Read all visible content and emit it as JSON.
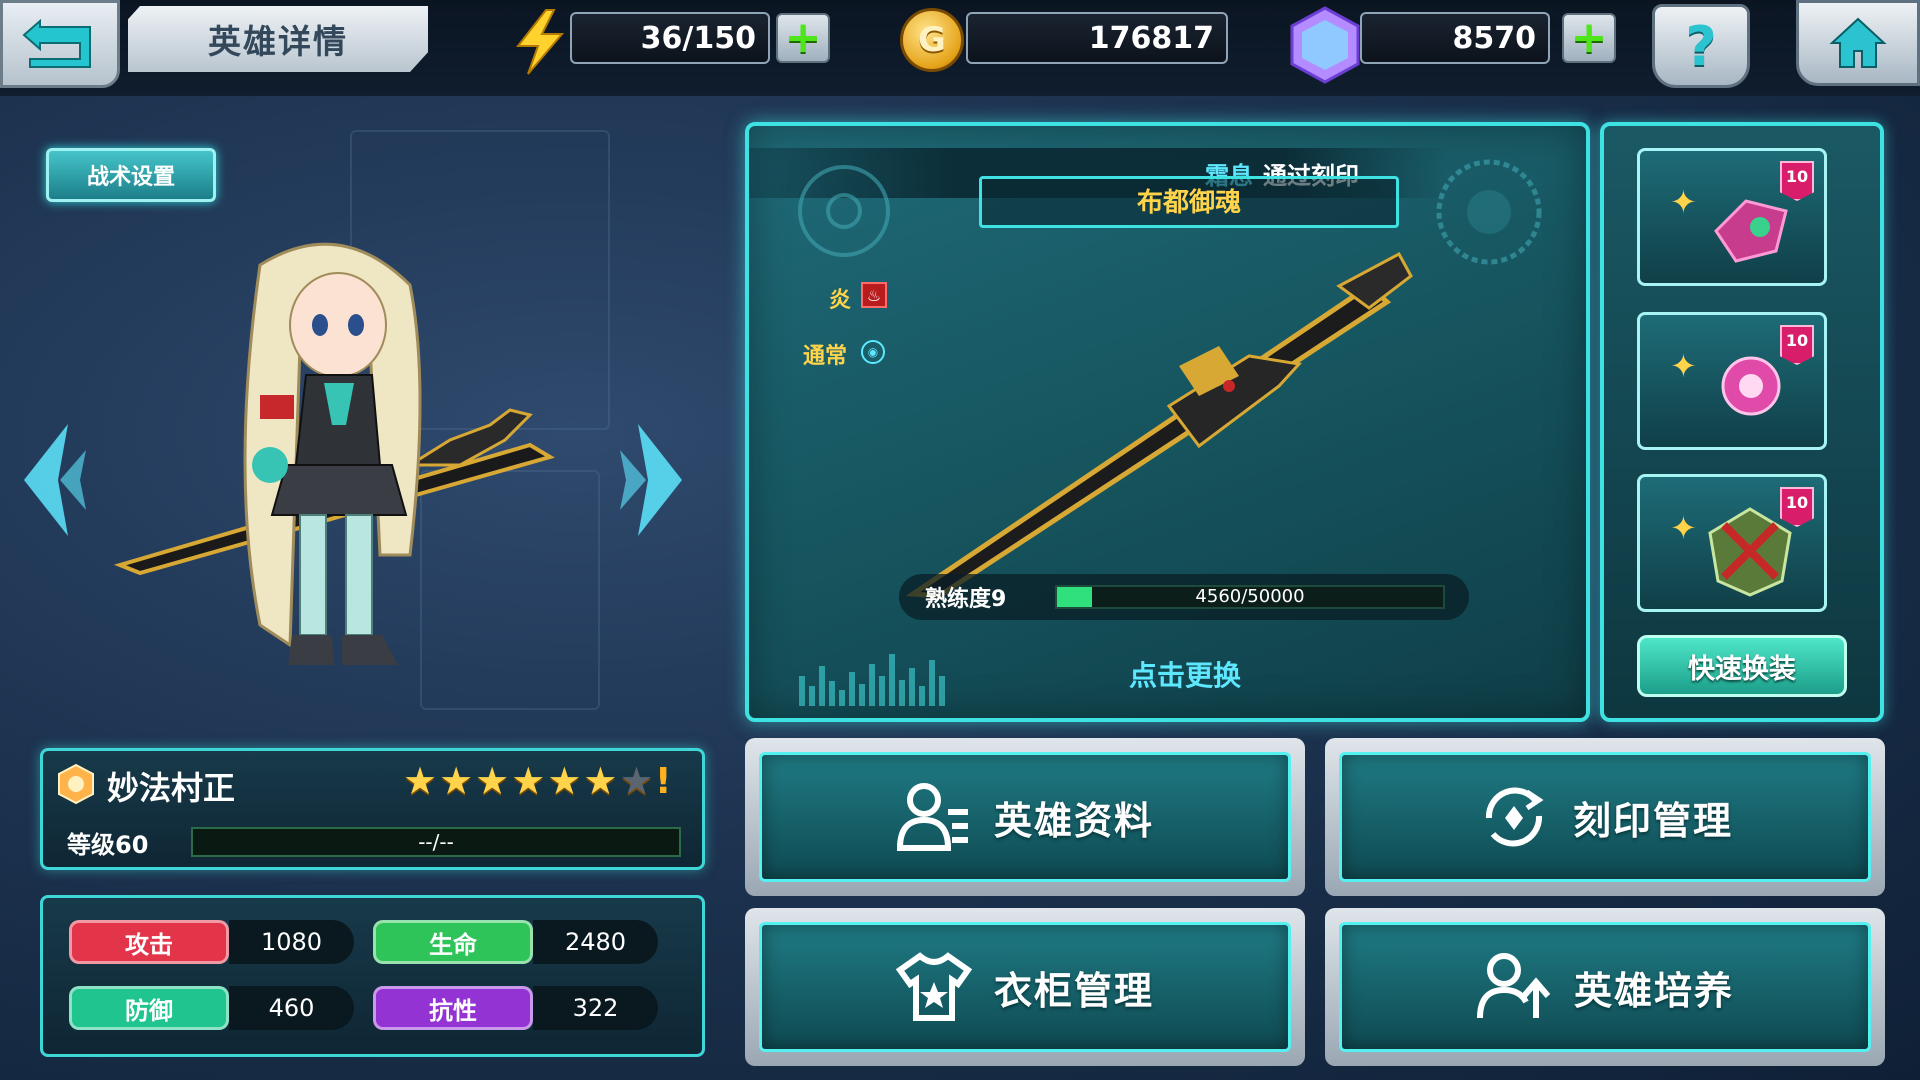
{
  "header": {
    "title": "英雄详情",
    "energy": "36/150",
    "gold": "176817",
    "gems": "8570",
    "gold_symbol": "G"
  },
  "tactics_label": "战术设置",
  "weapon": {
    "banner_left": "霜息",
    "banner_right": "通过刻印",
    "name": "布都御魂",
    "element_label": "炎",
    "type_label": "通常",
    "proficiency_label": "熟练度9",
    "proficiency_value": "4560/50000",
    "proficiency_fraction": 0.0912,
    "change_label": "点击更换"
  },
  "slots": [
    {
      "level": "10",
      "icon": "pink-mech-fish-icon"
    },
    {
      "level": "10",
      "icon": "pink-orb-creature-icon"
    },
    {
      "level": "10",
      "icon": "green-red-crest-icon"
    }
  ],
  "quick_equip_label": "快速换装",
  "hero": {
    "name": "妙法村正",
    "stars_filled": 6,
    "stars_total": 7,
    "level_label": "等级60",
    "exp_value": "--/--"
  },
  "stats": [
    {
      "label": "攻击",
      "value": "1080",
      "color": "#e2354a"
    },
    {
      "label": "生命",
      "value": "2480",
      "color": "#2fc45a"
    },
    {
      "label": "防御",
      "value": "460",
      "color": "#20c48e"
    },
    {
      "label": "抗性",
      "value": "322",
      "color": "#9333d4"
    }
  ],
  "menu": {
    "hero_info": "英雄资料",
    "seal_manage": "刻印管理",
    "wardrobe": "衣柜管理",
    "hero_train": "英雄培养"
  },
  "colors": {
    "accent": "#3fe2e2",
    "gold": "#ffd34a",
    "exp_fill": "#2fe07c"
  }
}
